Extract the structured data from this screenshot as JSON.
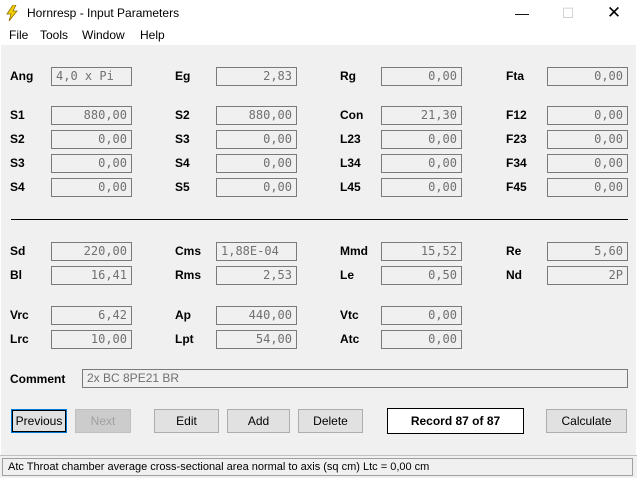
{
  "window": {
    "title": "Hornresp - Input Parameters"
  },
  "menu": [
    "File",
    "Tools",
    "Window",
    "Help"
  ],
  "fields": [
    {
      "id": "ang",
      "label": "Ang",
      "value": "4,0 x Pi",
      "align": "left"
    },
    {
      "id": "eg",
      "label": "Eg",
      "value": "2,83",
      "align": "right"
    },
    {
      "id": "rg",
      "label": "Rg",
      "value": "0,00",
      "align": "right"
    },
    {
      "id": "fta",
      "label": "Fta",
      "value": "0,00",
      "align": "right"
    },
    {
      "id": "s1a",
      "label": "S1",
      "value": "880,00",
      "align": "right"
    },
    {
      "id": "s2b",
      "label": "S2",
      "value": "880,00",
      "align": "right"
    },
    {
      "id": "con",
      "label": "Con",
      "value": "21,30",
      "align": "right"
    },
    {
      "id": "f12",
      "label": "F12",
      "value": "0,00",
      "align": "right"
    },
    {
      "id": "s2a",
      "label": "S2",
      "value": "0,00",
      "align": "right"
    },
    {
      "id": "s3b",
      "label": "S3",
      "value": "0,00",
      "align": "right"
    },
    {
      "id": "l23",
      "label": "L23",
      "value": "0,00",
      "align": "right"
    },
    {
      "id": "f23",
      "label": "F23",
      "value": "0,00",
      "align": "right"
    },
    {
      "id": "s3a",
      "label": "S3",
      "value": "0,00",
      "align": "right"
    },
    {
      "id": "s4b",
      "label": "S4",
      "value": "0,00",
      "align": "right"
    },
    {
      "id": "l34",
      "label": "L34",
      "value": "0,00",
      "align": "right"
    },
    {
      "id": "f34",
      "label": "F34",
      "value": "0,00",
      "align": "right"
    },
    {
      "id": "s4a",
      "label": "S4",
      "value": "0,00",
      "align": "right"
    },
    {
      "id": "s5b",
      "label": "S5",
      "value": "0,00",
      "align": "right"
    },
    {
      "id": "l45",
      "label": "L45",
      "value": "0,00",
      "align": "right"
    },
    {
      "id": "f45",
      "label": "F45",
      "value": "0,00",
      "align": "right"
    },
    {
      "id": "sd",
      "label": "Sd",
      "value": "220,00",
      "align": "right"
    },
    {
      "id": "cms",
      "label": "Cms",
      "value": "1,88E-04",
      "align": "left"
    },
    {
      "id": "mmd",
      "label": "Mmd",
      "value": "15,52",
      "align": "right"
    },
    {
      "id": "re",
      "label": "Re",
      "value": "5,60",
      "align": "right"
    },
    {
      "id": "bl",
      "label": "Bl",
      "value": "16,41",
      "align": "right"
    },
    {
      "id": "rms",
      "label": "Rms",
      "value": "2,53",
      "align": "right"
    },
    {
      "id": "le",
      "label": "Le",
      "value": "0,50",
      "align": "right"
    },
    {
      "id": "nd",
      "label": "Nd",
      "value": "2P",
      "align": "right"
    },
    {
      "id": "vrc",
      "label": "Vrc",
      "value": "6,42",
      "align": "right"
    },
    {
      "id": "ap",
      "label": "Ap",
      "value": "440,00",
      "align": "right"
    },
    {
      "id": "vtc",
      "label": "Vtc",
      "value": "0,00",
      "align": "right"
    },
    {
      "id": "lrc",
      "label": "Lrc",
      "value": "10,00",
      "align": "right"
    },
    {
      "id": "lpt",
      "label": "Lpt",
      "value": "54,00",
      "align": "right"
    },
    {
      "id": "atc",
      "label": "Atc",
      "value": "0,00",
      "align": "right"
    }
  ],
  "comment": {
    "label": "Comment",
    "value": "2x BC 8PE21 BR"
  },
  "buttons": {
    "previous": "Previous",
    "next": "Next",
    "edit": "Edit",
    "add": "Add",
    "delete": "Delete",
    "calculate": "Calculate"
  },
  "record": "Record 87 of 87",
  "status": "Atc   Throat chamber average cross-sectional area normal to axis  (sq cm)   Ltc = 0,00 cm"
}
